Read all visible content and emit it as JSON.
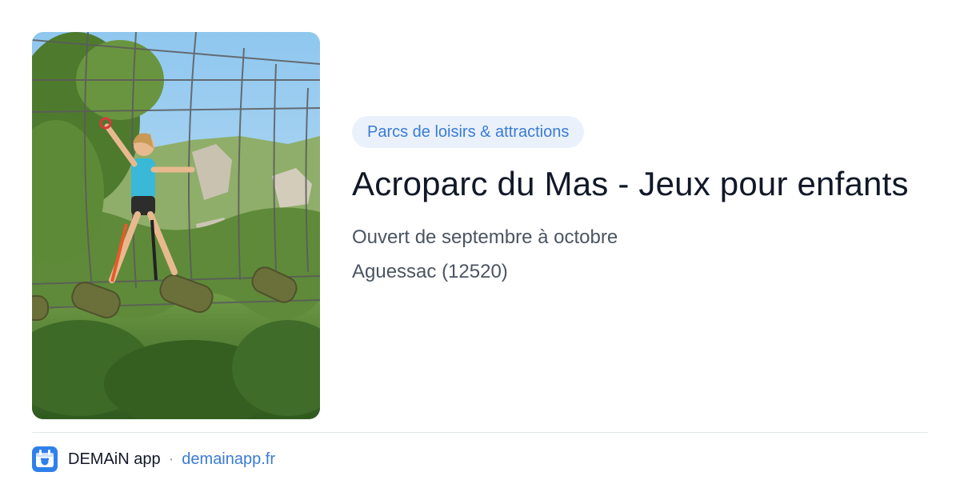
{
  "listing": {
    "category": "Parcs de loisirs & attractions",
    "title": "Acroparc du Mas - Jeux pour enfants",
    "hours": "Ouvert de septembre à octobre",
    "location": "Aguessac (12520)",
    "photo_icon": "photo-child-ropes-course"
  },
  "footer": {
    "app_name": "DEMAiN app",
    "separator": "·",
    "url": "demainapp.fr",
    "logo_icon": "demain-app-logo-icon"
  },
  "colors": {
    "accent": "#3a7bd5",
    "badge_bg": "#eaf1fb",
    "title": "#111827",
    "meta": "#4b5563",
    "logo_bg": "#2f80ed"
  }
}
